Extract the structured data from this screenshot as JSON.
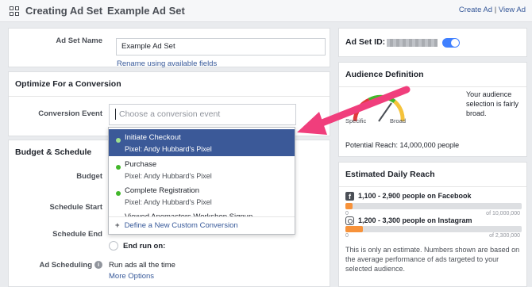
{
  "header": {
    "title": "Creating Ad Set",
    "adset_name": "Example Ad Set",
    "create_ad_link": "Create Ad",
    "separator": "|",
    "view_ad_link": "View Ad"
  },
  "ad_set_name": {
    "label": "Ad Set Name",
    "value": "Example Ad Set",
    "rename_link": "Rename using available fields"
  },
  "optimize": {
    "heading": "Optimize For a Conversion",
    "event_label": "Conversion Event",
    "event_placeholder": "Choose a conversion event",
    "options": [
      {
        "name": "Initiate Checkout",
        "pixel": "Pixel: Andy Hubbard's Pixel",
        "highlighted": true
      },
      {
        "name": "Purchase",
        "pixel": "Pixel: Andy Hubbard's Pixel",
        "highlighted": false
      },
      {
        "name": "Complete Registration",
        "pixel": "Pixel: Andy Hubbard's Pixel",
        "highlighted": false
      },
      {
        "name": "Viewed Apomasters Workshop Signup",
        "pixel": "",
        "highlighted": false
      }
    ],
    "define_custom": "Define a New Custom Conversion"
  },
  "budget": {
    "heading": "Budget & Schedule",
    "budget_label": "Budget",
    "schedule_start_label": "Schedule Start",
    "schedule_end_label": "Schedule End",
    "end_run_on": "End run on:",
    "ad_scheduling_label": "Ad Scheduling",
    "ad_scheduling_value": "Run ads all the time",
    "more_options": "More Options"
  },
  "right": {
    "adset_id_label": "Ad Set ID:",
    "audience_heading": "Audience Definition",
    "gauge_specific": "Specific",
    "gauge_broad": "Broad",
    "audience_desc": "Your audience selection is fairly broad.",
    "potential_reach": "Potential Reach: 14,000,000 people",
    "daily_reach_heading": "Estimated Daily Reach",
    "facebook_reach": "1,100 - 2,900 people on Facebook",
    "facebook_min": "0",
    "facebook_max": "of 10,000,000",
    "facebook_fill": 0.04,
    "instagram_reach": "1,200 - 3,300 people on Instagram",
    "instagram_min": "0",
    "instagram_max": "of 2,300,000",
    "instagram_fill": 0.1,
    "estimate_note": "This is only an estimate. Numbers shown are based on the average performance of ads targeted to your selected audience."
  },
  "colors": {
    "accent": "#3b5998",
    "link": "#365899",
    "arrow": "#f03e7c",
    "bar": "#f7923a",
    "toggle": "#4080ff"
  }
}
